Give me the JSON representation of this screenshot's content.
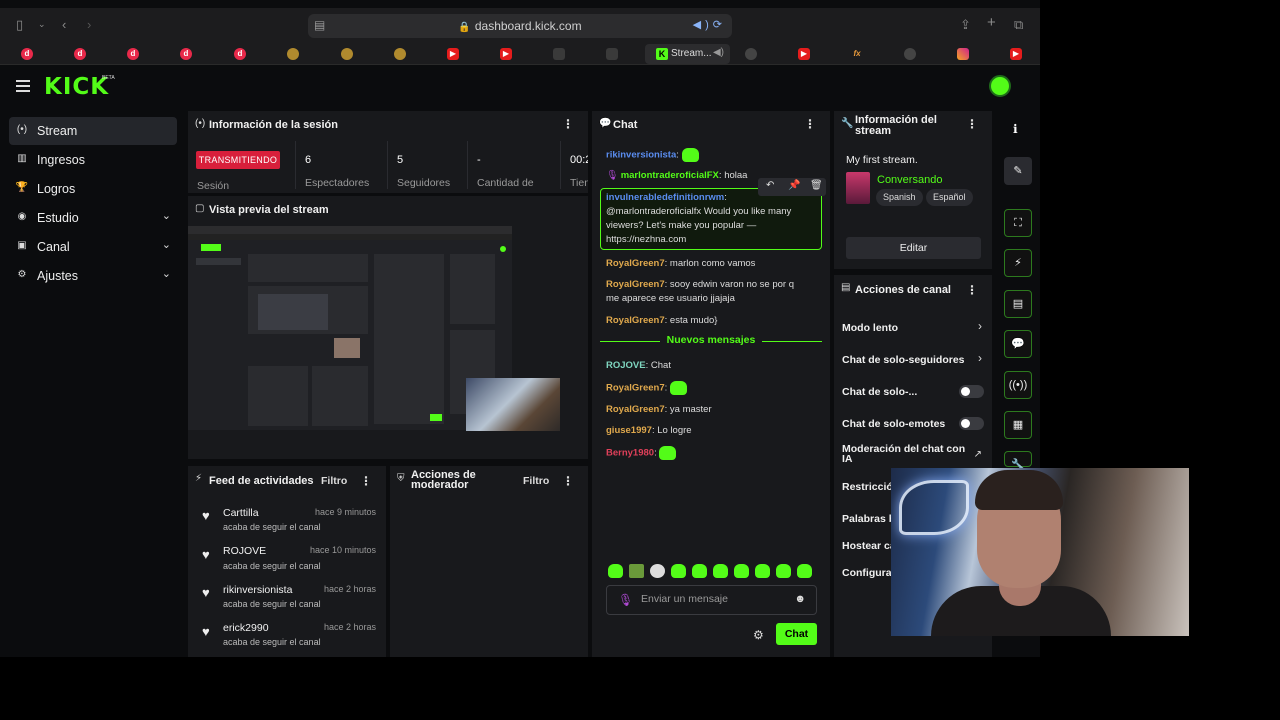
{
  "browser": {
    "url": "dashboard.kick.com",
    "active_tab_title": "Stream..."
  },
  "kick": {
    "logo": "KICK",
    "badge": "BETA"
  },
  "sidebar": {
    "items": [
      {
        "label": "Stream",
        "icon": "broadcast-icon"
      },
      {
        "label": "Ingresos",
        "icon": "chart-icon"
      },
      {
        "label": "Logros",
        "icon": "trophy-icon"
      },
      {
        "label": "Estudio",
        "icon": "studio-icon"
      },
      {
        "label": "Canal",
        "icon": "user-icon"
      },
      {
        "label": "Ajustes",
        "icon": "gear-icon"
      }
    ]
  },
  "session": {
    "title": "Información de la sesión",
    "status": "TRANSMITIENDO",
    "status_label": "Sesión",
    "stats": [
      {
        "value": "6",
        "label": "Espectadores"
      },
      {
        "value": "5",
        "label": "Seguidores"
      },
      {
        "value": "-",
        "label": "Cantidad de"
      },
      {
        "value": "00:2",
        "label": "Tiem"
      }
    ]
  },
  "preview": {
    "title": "Vista previa del stream"
  },
  "feed": {
    "title": "Feed de actividades",
    "filter": "Filtro",
    "items": [
      {
        "name": "Carttilla",
        "time": "hace 9 minutos",
        "action": "acaba de seguir el canal"
      },
      {
        "name": "ROJOVE",
        "time": "hace 10 minutos",
        "action": "acaba de seguir el canal"
      },
      {
        "name": "rikinversionista",
        "time": "hace 2 horas",
        "action": "acaba de seguir el canal"
      },
      {
        "name": "erick2990",
        "time": "hace 2 horas",
        "action": "acaba de seguir el canal"
      }
    ]
  },
  "mod_actions": {
    "title": "Acciones de moderador",
    "filter": "Filtro"
  },
  "chat": {
    "title": "Chat",
    "messages": [
      {
        "user": "rikinversionista",
        "text": "",
        "color": "#5a8df0",
        "emote": true
      },
      {
        "user": "marlontraderoficialFX",
        "text": "holaa",
        "color": "#53fc18",
        "emote": false
      },
      {
        "user": "invulnerabledefinitionrwm",
        "text": "@marlontraderoficialfx Would you like many viewers? Let's make you popular — https://nezhna.com",
        "color": "#5a8df0",
        "emote": false
      },
      {
        "user": "RoyalGreen7",
        "text": "marlon como vamos",
        "color": "#e0a94d",
        "emote": false
      },
      {
        "user": "RoyalGreen7",
        "text": "sooy edwin varon no se por q me aparece ese usuario jjajaja",
        "color": "#e0a94d",
        "emote": false
      },
      {
        "user": "RoyalGreen7",
        "text": "esta mudo}",
        "color": "#e0a94d",
        "emote": false
      }
    ],
    "new_divider": "Nuevos mensajes",
    "new_messages": [
      {
        "user": "ROJOVE",
        "text": "Chat",
        "color": "#7fd6c0",
        "emote": false
      },
      {
        "user": "RoyalGreen7",
        "text": "",
        "color": "#e0a94d",
        "emote": true
      },
      {
        "user": "RoyalGreen7",
        "text": "ya master",
        "color": "#e0a94d",
        "emote": false
      },
      {
        "user": "giuse1997",
        "text": "Lo logre",
        "color": "#e0a94d",
        "emote": false
      },
      {
        "user": "Berny1980",
        "text": "",
        "color": "#e0405a",
        "emote": true
      }
    ],
    "input_placeholder": "Enviar un mensaje",
    "send_label": "Chat"
  },
  "stream_info": {
    "title": "Información del stream",
    "stream_title": "My first stream.",
    "category": "Conversando",
    "tags": [
      "Spanish",
      "Español"
    ],
    "edit_label": "Editar"
  },
  "channel_actions": {
    "title": "Acciones de canal",
    "items": [
      {
        "label": "Modo lento",
        "control": "chevron"
      },
      {
        "label": "Chat de solo-seguidores",
        "control": "chevron"
      },
      {
        "label": "Chat de solo-...",
        "control": "toggle",
        "on": false
      },
      {
        "label": "Chat de solo-emotes",
        "control": "toggle",
        "on": false
      },
      {
        "label": "Moderación del chat con IA",
        "control": "external"
      },
      {
        "label": "Restricció",
        "control": "none"
      },
      {
        "label": "Palabras b",
        "control": "none"
      },
      {
        "label": "Hostear ca",
        "control": "none"
      },
      {
        "label": "Configura",
        "control": "none"
      }
    ]
  },
  "colors": {
    "brand": "#53fc18",
    "live": "#d81f3b",
    "panel": "#18191c",
    "background": "#0b0c0e"
  }
}
